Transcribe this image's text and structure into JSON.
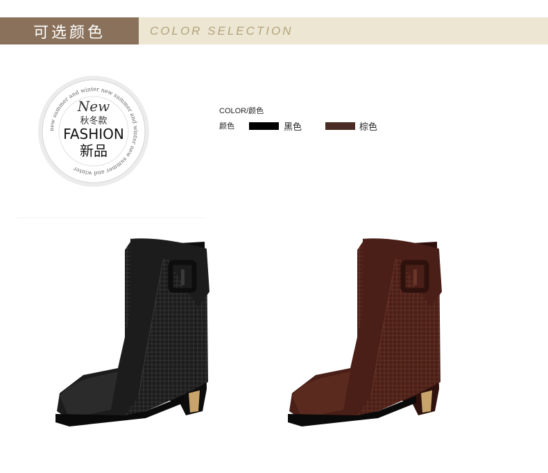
{
  "header": {
    "title_cn": "可选颜色",
    "title_en": "COLOR SELECTION"
  },
  "badge": {
    "script": "New",
    "season": "秋冬款",
    "fashion": "FASHION",
    "new_product": "新品",
    "ring_text": "new summer and winter new summer and winter new summer and winter"
  },
  "legend": {
    "title": "COLOR/颜色",
    "row_label": "颜色",
    "colors": [
      {
        "name": "黑色",
        "hex": "#000000"
      },
      {
        "name": "棕色",
        "hex": "#4a2b25"
      }
    ]
  },
  "products": [
    {
      "color_name": "黑色",
      "main": "#1c1c1c",
      "shade": "#0d0d0d",
      "highlight": "#3a3a3a"
    },
    {
      "color_name": "棕色",
      "main": "#4a1f17",
      "shade": "#2e110c",
      "highlight": "#6b3528"
    }
  ]
}
